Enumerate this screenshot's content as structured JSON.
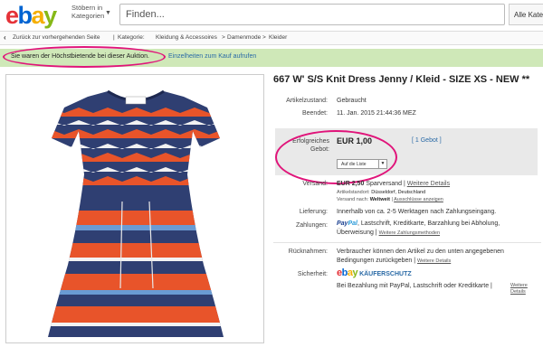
{
  "header": {
    "logo_letters": [
      "e",
      "b",
      "a",
      "y"
    ],
    "logo_colors": [
      "#e53238",
      "#0064d2",
      "#f5af02",
      "#86b817"
    ],
    "category_label": "Stöbern in Kategorien",
    "search_placeholder": "Finden...",
    "all_categories": "Alle Kateg"
  },
  "breadcrumb": {
    "back": "Zurück zur vorhergehenden Seite",
    "label": "Kategorie:",
    "items": [
      "Kleidung & Accessoires",
      "Damenmode",
      "Kleider"
    ]
  },
  "notice": {
    "message": "Sie waren der Höchstbietende bei dieser Auktion.",
    "link": "Einzelheiten zum Kauf aufrufen"
  },
  "item": {
    "title": "667 W' S/S Knit Dress Jenny / Kleid - SIZE XS - NEW **",
    "condition_label": "Artikelzustand:",
    "condition_value": "Gebraucht",
    "ended_label": "Beendet:",
    "ended_value": "11. Jan. 2015  21:44:36 MEZ",
    "bid_label": "Erfolgreiches Gebot:",
    "bid_value": "EUR 1,00",
    "bid_count": "[ 1 Gebot ]",
    "watch_button": "Auf die Liste",
    "shipping_label": "Versand:",
    "shipping_price": "EUR 2,50",
    "shipping_type": "Sparversand",
    "shipping_more": "Weitere Details",
    "location_label": "Artikelstandort:",
    "location_value": "Düsseldorf, Deutschland",
    "ships_to_label": "Versand nach:",
    "ships_to_value": "Weltweit",
    "exclusions": "Ausschlüsse anzeigen",
    "delivery_label": "Lieferung:",
    "delivery_value": "Innerhalb von ca. 2-5 Werktagen nach Zahlungseingang.",
    "payment_label": "Zahlungen:",
    "payment_paypal_a": "Pay",
    "payment_paypal_b": "Pal",
    "payment_methods_1": ", Lastschrift,  Kreditkarte,  Barzahlung bei Abholung,",
    "payment_methods_2": "Überweisung",
    "payment_more": "Weitere Zahlungsmethoden",
    "returns_label": "Rücknahmen:",
    "returns_line1": "Verbraucher können den Artikel zu den unten angegebenen",
    "returns_line2": "Bedingungen zurückgeben |",
    "returns_more": "Weitere Details",
    "security_label": "Sicherheit:",
    "buyer_protection": "KÄUFERSCHUTZ",
    "security_text": "Bei Bezahlung mit PayPal, Lastschrift oder Kreditkarte |",
    "security_more_1": "Weitere",
    "security_more_2": "Details"
  },
  "dress_colors": {
    "navy": "#2f3f72",
    "orange": "#e8542a",
    "white": "#f2f2f2",
    "light_blue": "#6a9bd3"
  },
  "accent_colors": {
    "annotation": "#e0147a",
    "notice_bg": "#cfe8b8",
    "link": "#2a6aa6"
  }
}
